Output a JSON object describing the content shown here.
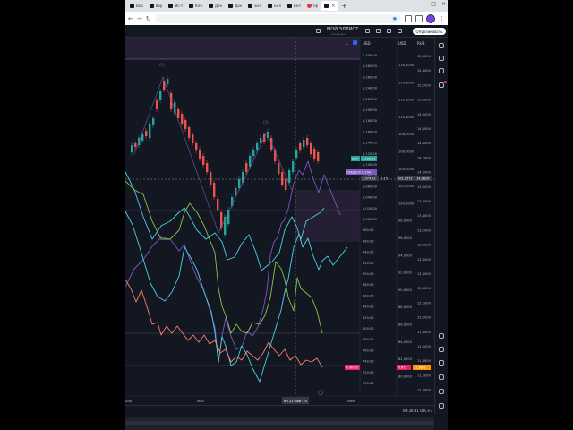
{
  "browser": {
    "tabs": [
      {
        "label": "Вор"
      },
      {
        "label": "Вор"
      },
      {
        "label": "ВСЧ"
      },
      {
        "label": "RUS"
      },
      {
        "label": "Дон"
      },
      {
        "label": "Дон"
      },
      {
        "label": "Бел"
      },
      {
        "label": "Бел"
      },
      {
        "label": "Бел"
      },
      {
        "label": "Пр"
      },
      {
        "label": "",
        "active": true
      }
    ],
    "publish_label": "Опубликовать"
  },
  "chart_header": {
    "title": "МОЙ ЭЛЛИОТ",
    "subtitle": "Сохранено"
  },
  "toolbar": {
    "interval": "L",
    "currency_left": "USD",
    "currency_mid": "USD",
    "currency_right": "RUB"
  },
  "axis_left": {
    "ticks": [
      "1,300.00",
      "1,280.00",
      "1,260.00",
      "1,240.00",
      "1,220.00",
      "1,200.00",
      "1,180.00",
      "1,160.00",
      "1,140.00",
      "1,120.00",
      "1,100.00",
      "1,080.00",
      "1,060.00",
      "1,040.00",
      "1,020.00",
      "1,000.00",
      "980.00",
      "960.00",
      "940.00",
      "920.00",
      "900.00",
      "880.00",
      "860.00",
      "840.00",
      "820.00",
      "800.00",
      "780.00",
      "760.00",
      "740.00",
      "720.00",
      "700.00",
      "680.00"
    ]
  },
  "axis_mid": {
    "ticks": [
      "116,0000",
      "114,0000",
      "112,0000",
      "110,0000",
      "108,0000",
      "106,0000",
      "104,0000",
      "102,0000",
      "100,0000",
      "98,0000",
      "96,0000",
      "94,0000",
      "92,0000",
      "90,0000",
      "88,0000",
      "86,0000",
      "84,0000",
      "82,0000",
      "80,0000",
      "78,0000",
      "76,0000",
      "74,0000",
      "72,0000",
      "70,0000"
    ]
  },
  "axis_right": {
    "ticks": [
      "15,6000",
      "15,4000",
      "15,2000",
      "15,0000",
      "14,8000",
      "14,6000",
      "14,4000",
      "14,2000",
      "14,0000",
      "13,8000",
      "13,6000",
      "13,4000",
      "13,2000",
      "13,0000",
      "12,8000",
      "12,6000",
      "12,4000",
      "12,2000",
      "12,0000",
      "11,8000",
      "11,6000",
      "11,4000",
      "11,2000",
      "11,0000"
    ]
  },
  "labels": {
    "spx_tag": "SPX",
    "spx_value": "1,106.21",
    "crosshair_tag": "СВЕДЕНО",
    "crosshair_value": "0,1947",
    "crosshair_price": "1,074.52",
    "crosshair_small": "8.15",
    "crosshair_mid": "101,2572",
    "crosshair_right": "14,0829",
    "bottom_left_tag": "RUBUSD",
    "bottom_right_tag": "PLNTZ",
    "bottom_right_value": "11,3601",
    "wave_top": "(1)",
    "wave_mid": "(3)"
  },
  "time_axis": {
    "labels": [
      "Апр",
      "Май",
      "Июн"
    ],
    "crosshair_date": "пн 12 Май '25"
  },
  "status": {
    "clock": "00:30:31 UTC+3"
  },
  "colors": {
    "bg": "#131722",
    "candle_up": "#26a69a",
    "candle_down": "#ef5350",
    "purple": "#7e57c2",
    "cyan": "#4dd0e1",
    "green": "#8bc34a",
    "salmon": "#ff7f6e"
  }
}
